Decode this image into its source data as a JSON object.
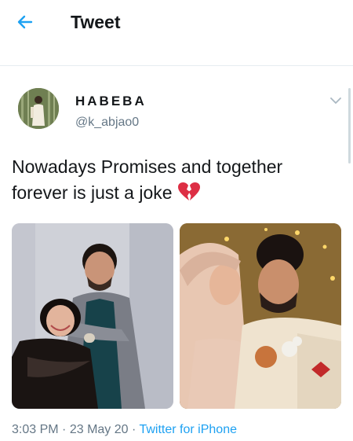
{
  "header": {
    "title": "Tweet",
    "back_icon": "arrow-left-icon",
    "accent_color": "#1da1f2"
  },
  "tweet": {
    "author": {
      "display_name": "HABEBA",
      "handle": "@k_abjao0"
    },
    "text": "Nowadays Promises and together forever is just a joke",
    "emoji_icon": "broken-heart-icon",
    "media": [
      {
        "icon": "photo-couple-hug"
      },
      {
        "icon": "photo-couple-wedding"
      }
    ],
    "time": "3:03 PM",
    "separator": "·",
    "date": "23 May 20",
    "source": "Twitter for iPhone"
  }
}
